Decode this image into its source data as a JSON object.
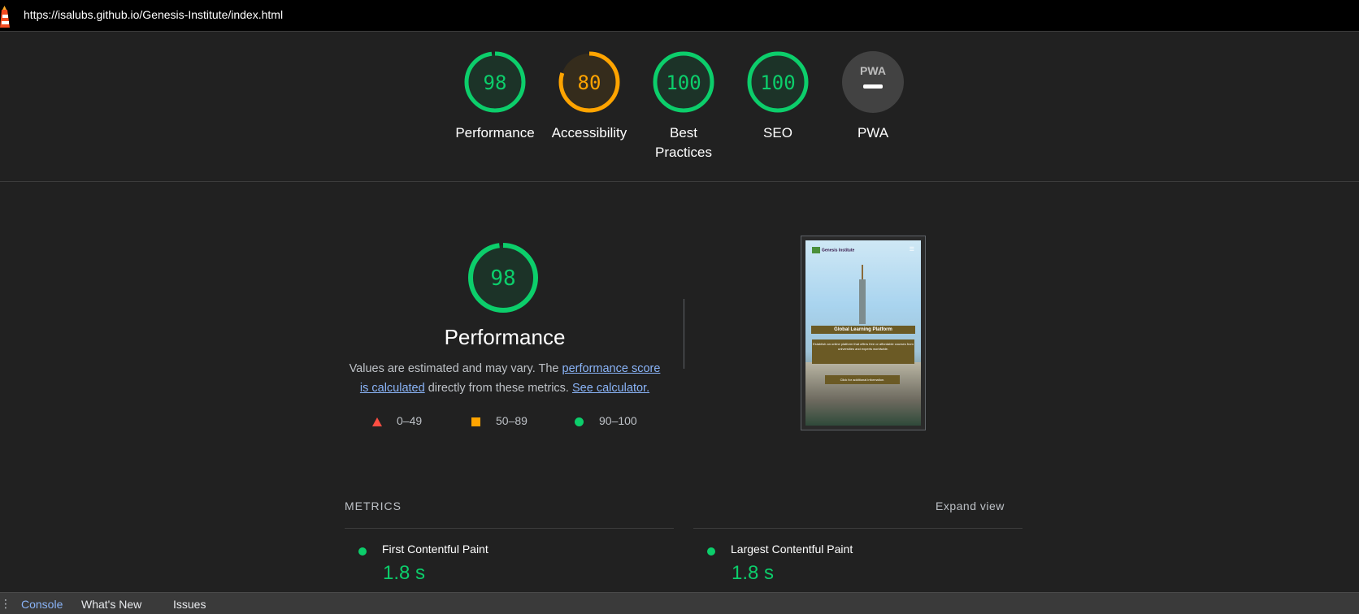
{
  "header": {
    "url": "https://isalubs.github.io/Genesis-Institute/index.html",
    "logo_icon": "lighthouse-icon"
  },
  "gauges": [
    {
      "score": "98",
      "label": "Performance",
      "color": "#0cce6b",
      "fraction": 0.98
    },
    {
      "score": "80",
      "label": "Accessibility",
      "color": "#ffa400",
      "fraction": 0.8
    },
    {
      "score": "100",
      "label": "Best Practices",
      "color": "#0cce6b",
      "fraction": 1.0
    },
    {
      "score": "100",
      "label": "SEO",
      "color": "#0cce6b",
      "fraction": 1.0
    },
    {
      "score": "",
      "label": "PWA",
      "badge": "PWA",
      "icon": "pwa-icon"
    }
  ],
  "performance": {
    "score": "98",
    "fraction": 0.98,
    "title": "Performance",
    "desc_prefix": "Values are estimated and may vary. The ",
    "link_score": "performance score is calculated",
    "desc_middle": " directly from these metrics.",
    "link_calculator": "See calculator.",
    "legend": [
      {
        "range": "0–49",
        "shape": "triangle",
        "color": "#ff4e42"
      },
      {
        "range": "50–89",
        "shape": "square",
        "color": "#ffa400"
      },
      {
        "range": "90–100",
        "shape": "circle",
        "color": "#0cce6b"
      }
    ]
  },
  "screenshot": {
    "brand": "Genesis Institute",
    "heading": "Global Learning Platform",
    "paragraph": "Establish an online platform that offers free or affordable courses from universities and experts worldwide.",
    "button": "Click for additional information."
  },
  "metrics": {
    "heading": "METRICS",
    "expand_label": "Expand view",
    "items": [
      {
        "name": "First Contentful Paint",
        "value": "1.8 s"
      },
      {
        "name": "Largest Contentful Paint",
        "value": "1.8 s"
      }
    ]
  },
  "drawer": {
    "tabs": [
      "Console",
      "What's New",
      "Issues"
    ]
  },
  "colors": {
    "good": "#0cce6b",
    "average": "#ffa400",
    "fail": "#ff4e42",
    "link": "#8ab4f8"
  }
}
